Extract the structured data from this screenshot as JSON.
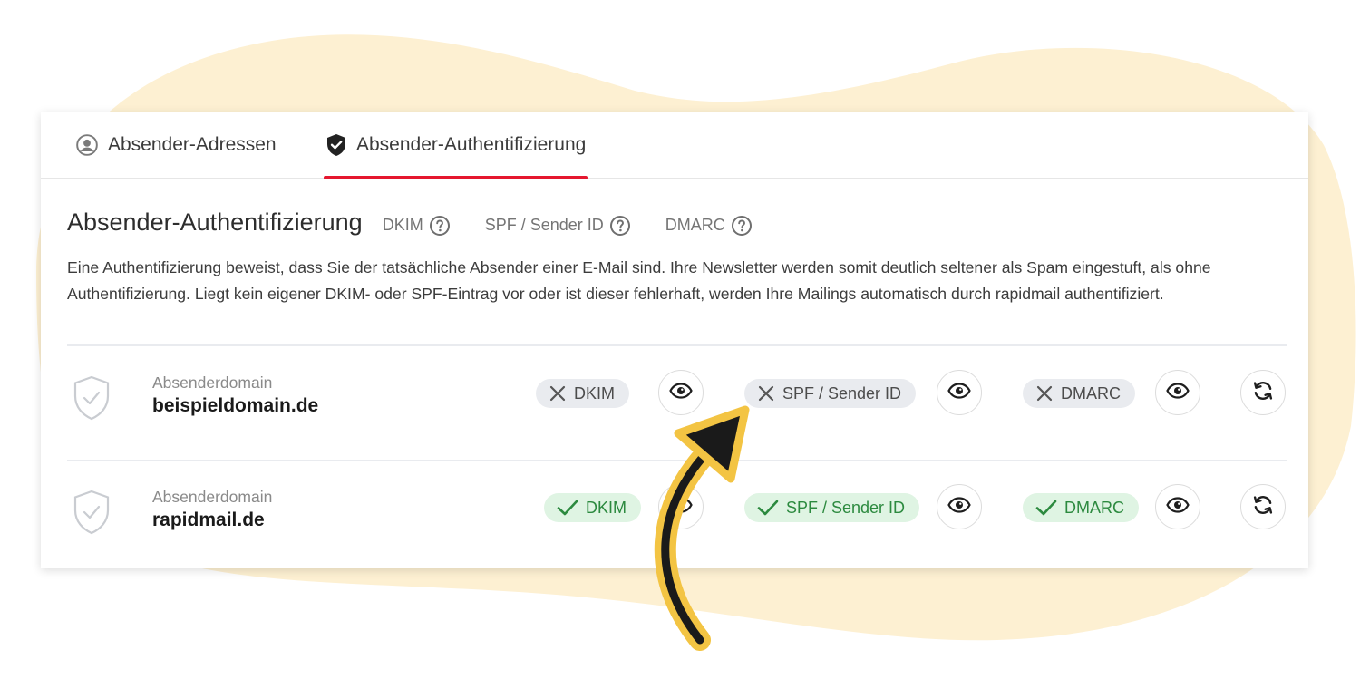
{
  "tabs": [
    {
      "label": "Absender-Adressen",
      "icon": "user-circle-icon"
    },
    {
      "label": "Absender-Authentifizierung",
      "icon": "shield-check-icon",
      "active": true
    }
  ],
  "header": {
    "title": "Absender-Authentifizierung",
    "help_links": [
      {
        "label": "DKIM",
        "icon": "help-icon"
      },
      {
        "label": "SPF / Sender ID",
        "icon": "help-icon"
      },
      {
        "label": "DMARC",
        "icon": "help-icon"
      }
    ]
  },
  "description": "Eine Authentifizierung beweist, dass Sie der tatsächliche Absender einer E-Mail sind. Ihre Newsletter werden somit deutlich seltener als Spam eingestuft, als ohne Authentifizierung. Liegt kein eigener DKIM- oder SPF-Eintrag vor oder ist dieser fehlerhaft, werden Ihre Mailings automatisch durch rapidmail authentifiziert.",
  "domains": [
    {
      "label": "Absenderdomain",
      "domain": "beispieldomain.de",
      "checks": [
        {
          "label": "DKIM",
          "status": "failed"
        },
        {
          "label": "SPF / Sender ID",
          "status": "failed"
        },
        {
          "label": "DMARC",
          "status": "failed"
        }
      ]
    },
    {
      "label": "Absenderdomain",
      "domain": "rapidmail.de",
      "checks": [
        {
          "label": "DKIM",
          "status": "ok"
        },
        {
          "label": "SPF / Sender ID",
          "status": "ok"
        },
        {
          "label": "DMARC",
          "status": "ok"
        }
      ]
    }
  ],
  "colors": {
    "accent": "#e5172f",
    "success_text": "#2c8a3f",
    "success_bg": "#dff4e3",
    "neutral_bg": "#e9ebef",
    "blob": "#fdf0d2",
    "arrow": "#f3c443"
  }
}
